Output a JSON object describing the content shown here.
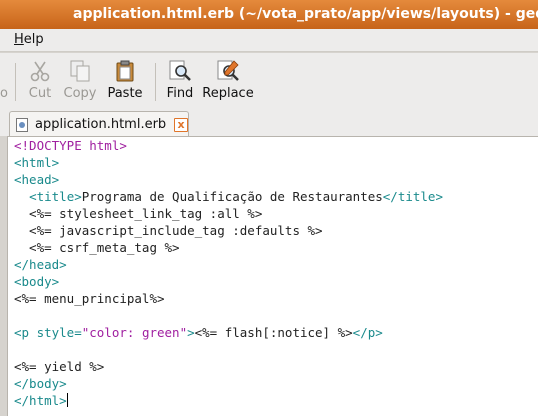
{
  "window": {
    "title": "application.html.erb (~/vota_prato/app/views/layouts) - gedit"
  },
  "menubar": {
    "help_first": "H",
    "help_rest": "elp"
  },
  "toolbar": {
    "left_cut_label": "o",
    "buttons": [
      {
        "label": "Cut",
        "icon": "scissors-icon",
        "enabled": false
      },
      {
        "label": "Copy",
        "icon": "copy-icon",
        "enabled": false
      },
      {
        "label": "Paste",
        "icon": "clipboard-icon",
        "enabled": true
      },
      {
        "label": "Find",
        "icon": "find-icon",
        "enabled": true
      },
      {
        "label": "Replace",
        "icon": "replace-icon",
        "enabled": true
      }
    ]
  },
  "tab": {
    "label": "application.html.erb",
    "close": "x"
  },
  "editor": {
    "lines": [
      [
        {
          "t": "<!DOCTYPE html>",
          "c": "doctype"
        }
      ],
      [
        {
          "t": "<html>",
          "c": "tag"
        }
      ],
      [
        {
          "t": "<head>",
          "c": "tag"
        }
      ],
      [
        {
          "t": "  ",
          "c": "erb"
        },
        {
          "t": "<title>",
          "c": "tag"
        },
        {
          "t": "Programa de Qualificação de Restaurantes",
          "c": "erb"
        },
        {
          "t": "</title>",
          "c": "tag"
        }
      ],
      [
        {
          "t": "  <%= stylesheet_link_tag :all %>",
          "c": "erb"
        }
      ],
      [
        {
          "t": "  <%= javascript_include_tag :defaults %>",
          "c": "erb"
        }
      ],
      [
        {
          "t": "  <%= csrf_meta_tag %>",
          "c": "erb"
        }
      ],
      [
        {
          "t": "</head>",
          "c": "tag"
        }
      ],
      [
        {
          "t": "<body>",
          "c": "tag"
        }
      ],
      [
        {
          "t": "<%= menu_principal%>",
          "c": "erb"
        }
      ],
      [
        {
          "t": "",
          "c": "erb"
        }
      ],
      [
        {
          "t": "<p ",
          "c": "tag"
        },
        {
          "t": "style=",
          "c": "attr"
        },
        {
          "t": "\"color: green\"",
          "c": "str"
        },
        {
          "t": ">",
          "c": "tag"
        },
        {
          "t": "<%= flash[:notice] %>",
          "c": "erb"
        },
        {
          "t": "</p>",
          "c": "tag"
        }
      ],
      [
        {
          "t": "",
          "c": "erb"
        }
      ],
      [
        {
          "t": "<%= yield %>",
          "c": "erb"
        }
      ],
      [
        {
          "t": "</body>",
          "c": "tag"
        }
      ],
      [
        {
          "t": "</html>",
          "c": "tag"
        }
      ]
    ]
  }
}
